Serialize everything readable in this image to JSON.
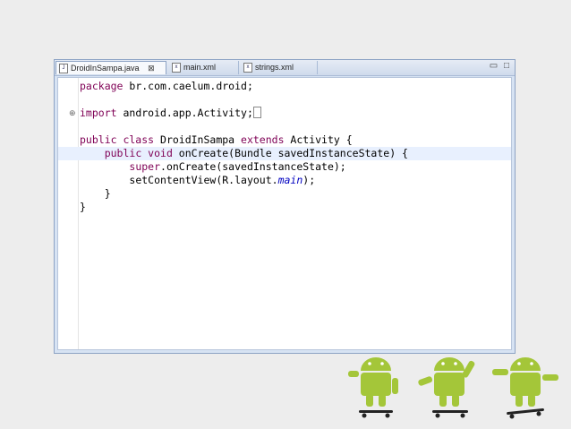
{
  "tabs": [
    {
      "label": "DroidInSampa.java",
      "active": true,
      "icon": "java-file-icon",
      "close": "⊠"
    },
    {
      "label": "main.xml",
      "active": false,
      "icon": "xml-file-icon"
    },
    {
      "label": "strings.xml",
      "active": false,
      "icon": "xml-file-icon"
    }
  ],
  "window_controls": {
    "minimize": "▭",
    "maximize": "□"
  },
  "code": {
    "l1_kw": "package",
    "l1_rest": " br.com.caelum.droid;",
    "l3_kw": "import",
    "l3_rest": " android.app.Activity;",
    "l5_kw1": "public class",
    "l5_mid": " DroidInSampa ",
    "l5_kw2": "extends",
    "l5_rest": " Activity {",
    "l6_indent": "    ",
    "l6_kw": "public void",
    "l6_rest": " onCreate(Bundle savedInstanceState) {",
    "l7_indent": "        ",
    "l7_kw": "super",
    "l7_rest": ".onCreate(savedInstanceState);",
    "l8_indent": "        ",
    "l8_pre": "setContentView(R.layout.",
    "l8_field": "main",
    "l8_post": ");",
    "l9": "    }",
    "l10": "}"
  },
  "colors": {
    "keyword": "#7f0055",
    "field": "#0000c0",
    "android_green": "#a4c639"
  }
}
